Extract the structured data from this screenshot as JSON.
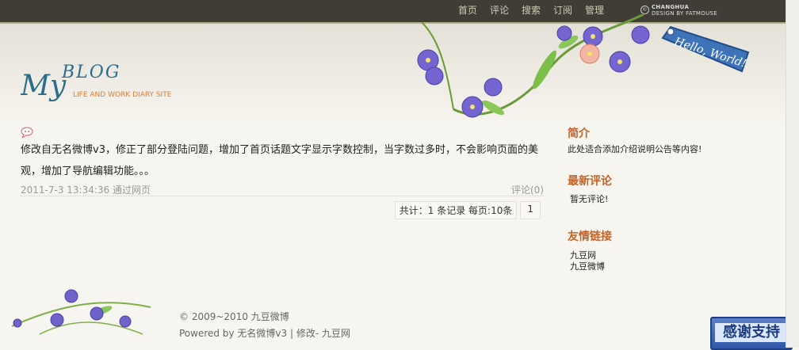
{
  "nav": {
    "items": [
      {
        "label": "首页"
      },
      {
        "label": "评论"
      },
      {
        "label": "搜索"
      },
      {
        "label": "订阅"
      },
      {
        "label": "管理"
      }
    ]
  },
  "credit": {
    "line1": "CHANGHUA",
    "line2": "DESIGN BY FATMOUSE",
    "mark": "©"
  },
  "logo": {
    "my": "My",
    "blog": "BLOG",
    "tagline": "LIFE AND WORK DIARY SITE"
  },
  "hello": {
    "text": "Hello, World!"
  },
  "post": {
    "text": "修改自无名微博v3，修正了部分登陆问题，增加了首页话题文字显示字数控制，当字数过多时，不会影响页面的美观，增加了导航编辑功能。。。",
    "date": "2011-7-3 13:34:36",
    "via": "通过网页",
    "comments": "评论(0)"
  },
  "pager": {
    "summary": "共计：1 条记录  每页:10条",
    "page": "1"
  },
  "sidebar": {
    "intro_title": "简介",
    "intro_text": "此处适合添加介绍说明公告等内容!",
    "comments_title": "最新评论",
    "comments_text": "暂无评论!",
    "links_title": "友情链接",
    "links": [
      {
        "label": "九豆网"
      },
      {
        "label": "九豆微博"
      }
    ]
  },
  "footer": {
    "copyright": "© 2009~2010 九豆微博",
    "powered_prefix": "Powered by",
    "powered_name": "无名微博v3",
    "separator": "|",
    "modified": "修改- 九豆网"
  },
  "thanks": {
    "label": "感谢支持"
  },
  "colors": {
    "accent": "#c0642a",
    "logo_blue": "#2b6b8c",
    "topbar": "#3f3d35",
    "flower": "#6f63c9"
  }
}
